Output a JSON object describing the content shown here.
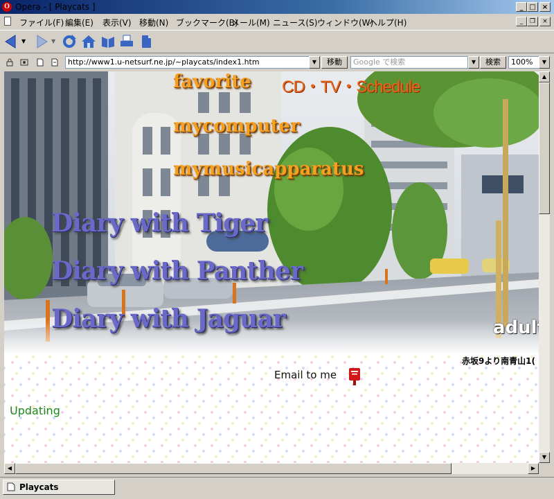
{
  "window": {
    "title": "Opera - [ Playcats ]",
    "logo_letter": "O"
  },
  "menu": [
    "ファイル(F)",
    "編集(E)",
    "表示(V)",
    "移動(N)",
    "ブックマーク(B)",
    "メール(M)",
    "ニュース(S)",
    "ウィンドウ(W)",
    "ヘルプ(H)"
  ],
  "address": {
    "url": "http://www1.u-netsurf.ne.jp/~playcats/index1.htm",
    "go_label": "移動",
    "search_placeholder": "Google で検索",
    "search_label": "検索",
    "zoom": "100%"
  },
  "page": {
    "nav_favorite": "favorite",
    "nav_schedule": "CD・TV・Schedule",
    "nav_computer": "mycomputer",
    "nav_music": "mymusicapparatus",
    "diary_tiger": "Diary with Tiger",
    "diary_panther": "Diary with Panther",
    "diary_jaguar": "Diary with Jaguar",
    "adult_label": "adult",
    "photo_caption": "赤坂9より南青山1(",
    "email_label": "Email to me",
    "updating_label": "Updating"
  },
  "tabs": [
    {
      "label": "Playcats"
    }
  ],
  "colors": {
    "title_gradient_start": "#0a246a",
    "nav_orange": "#f5a020",
    "diary_purple": "#6a69c8",
    "updating_green": "#1a8a1a",
    "mailbox_red": "#d01818"
  }
}
